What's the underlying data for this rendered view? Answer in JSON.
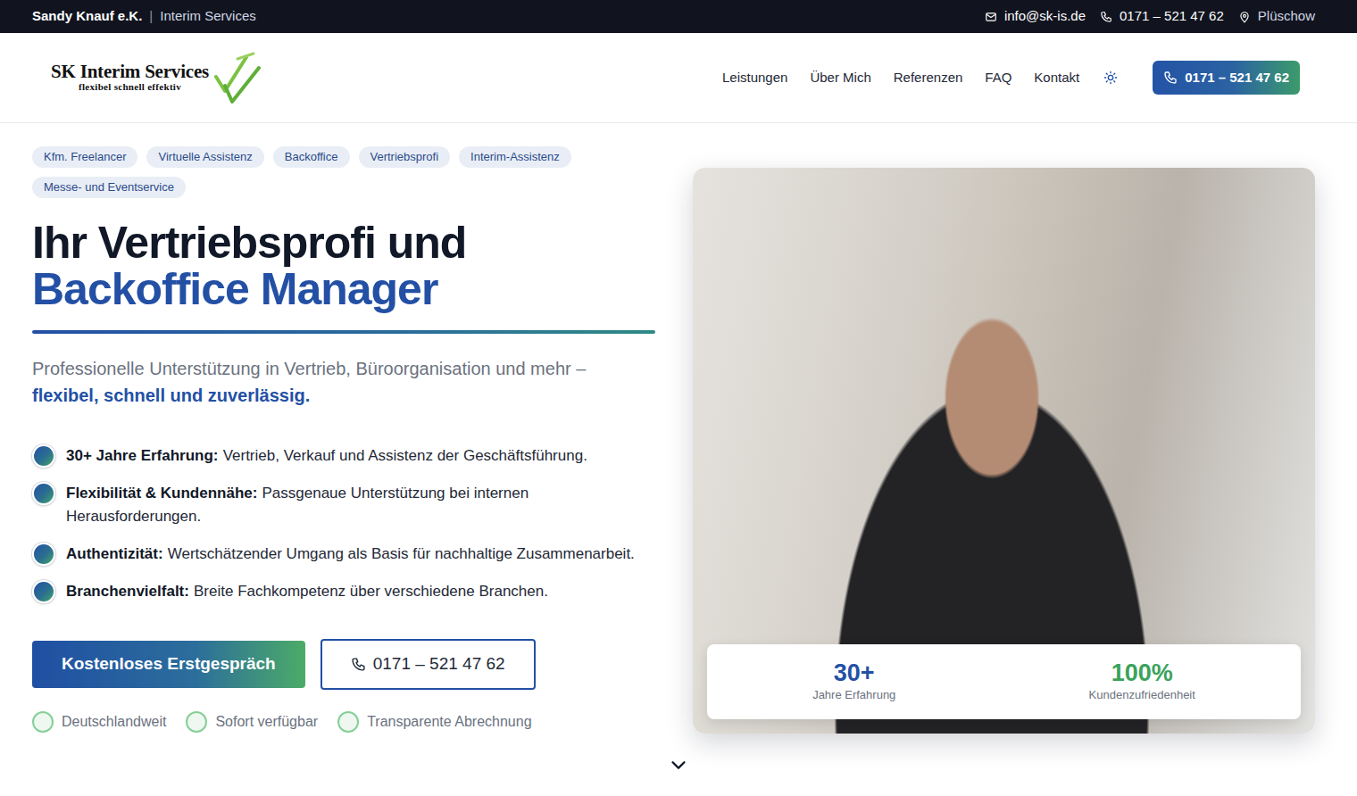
{
  "topbar": {
    "company": "Sandy Knauf e.K.",
    "separator": "|",
    "tagline": "Interim Services",
    "email": "info@sk-is.de",
    "phone": "0171 – 521 47 62",
    "location": "Plüschow"
  },
  "logo": {
    "title": "SK Interim Services",
    "slogan": "flexibel schnell effektiv"
  },
  "nav": {
    "items": [
      "Leistungen",
      "Über Mich",
      "Referenzen",
      "FAQ",
      "Kontakt"
    ],
    "cta": "0171 – 521 47 62"
  },
  "hero": {
    "tags": [
      "Kfm. Freelancer",
      "Virtuelle Assistenz",
      "Backoffice",
      "Vertriebsprofi",
      "Interim-Assistenz",
      "Messe- und Eventservice"
    ],
    "title_line1": "Ihr Vertriebsprofi und",
    "title_line2": "Backoffice Manager",
    "subtitle": "Professionelle Unterstützung in Vertrieb, Büroorganisation und mehr –",
    "subtitle_highlight": "flexibel, schnell und zuverlässig.",
    "features": [
      {
        "label": "30+ Jahre Erfahrung:",
        "text": "Vertrieb, Verkauf und Assistenz der Geschäftsführung."
      },
      {
        "label": "Flexibilität & Kundennähe:",
        "text": "Passgenaue Unterstützung bei internen Herausforderungen."
      },
      {
        "label": "Authentizität:",
        "text": "Wertschätzender Umgang als Basis für nachhaltige Zusammenarbeit."
      },
      {
        "label": "Branchenvielfalt:",
        "text": "Breite Fachkompetenz über verschiedene Branchen."
      }
    ],
    "primary_button": "Kostenloses Erstgespräch",
    "phone_button": "0171 – 521 47 62",
    "badges": [
      "Deutschlandweit",
      "Sofort verfügbar",
      "Transparente Abrechnung"
    ]
  },
  "photo_card": {
    "stats": [
      {
        "value": "30+",
        "label": "Jahre Erfahrung",
        "color": "#2350a5"
      },
      {
        "value": "100%",
        "label": "Kundenzufriedenheit",
        "color": "#3aa35a"
      }
    ]
  }
}
